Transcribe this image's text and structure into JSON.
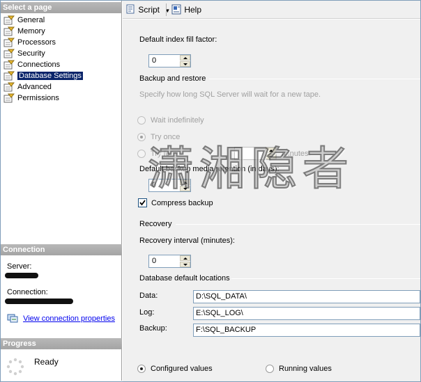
{
  "left": {
    "select_page_header": "Select a page",
    "pages": [
      {
        "label": "General"
      },
      {
        "label": "Memory"
      },
      {
        "label": "Processors"
      },
      {
        "label": "Security"
      },
      {
        "label": "Connections"
      },
      {
        "label": "Database Settings",
        "selected": true
      },
      {
        "label": "Advanced"
      },
      {
        "label": "Permissions"
      }
    ],
    "connection_header": "Connection",
    "server_label": "Server:",
    "connection_label": "Connection:",
    "view_connection_properties": "View connection properties",
    "progress_header": "Progress",
    "progress_status": "Ready"
  },
  "toolbar": {
    "script_label": "Script",
    "help_label": "Help"
  },
  "settings": {
    "default_index_fill_factor_label": "Default index fill factor:",
    "default_index_fill_factor_value": "0",
    "backup_restore_group": "Backup and restore",
    "tape_wait_desc": "Specify how long SQL Server will wait for a new tape.",
    "wait_indefinitely": "Wait indefinitely",
    "try_once": "Try once",
    "try_for": "Try for",
    "minutes_suffix": "minutes",
    "retention_label": "Default backup media retention (in days):",
    "retention_value": "0",
    "compress_backup": "Compress backup",
    "recovery_group": "Recovery",
    "recovery_interval_label": "Recovery interval (minutes):",
    "recovery_interval_value": "0",
    "db_locations_group": "Database default locations",
    "data_label": "Data:",
    "data_value": "D:\\SQL_DATA\\",
    "log_label": "Log:",
    "log_value": "E:\\SQL_LOG\\",
    "backup_label": "Backup:",
    "backup_value": "F:\\SQL_BACKUP",
    "configured_values": "Configured values",
    "running_values": "Running values"
  },
  "watermark": "潇湘隐者"
}
